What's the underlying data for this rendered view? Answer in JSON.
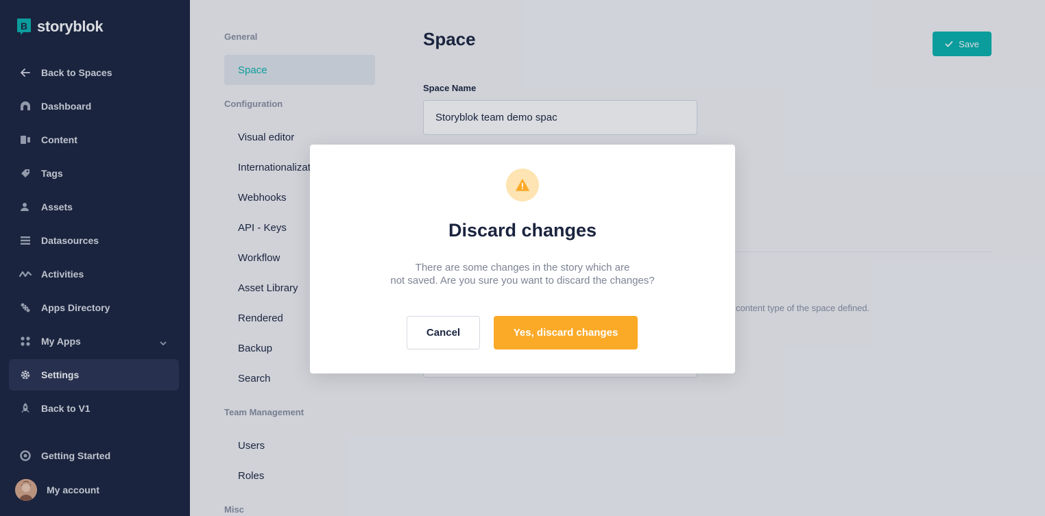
{
  "brand": {
    "name": "storyblok",
    "accent": "#09b3af",
    "sidebar_bg": "#1b243f",
    "warning": "#fbaa28"
  },
  "sidebar": {
    "items": [
      {
        "label": "Back to Spaces",
        "icon": "arrow-left-icon"
      },
      {
        "label": "Dashboard",
        "icon": "dashboard-icon"
      },
      {
        "label": "Content",
        "icon": "content-icon"
      },
      {
        "label": "Tags",
        "icon": "tag-icon"
      },
      {
        "label": "Assets",
        "icon": "assets-icon"
      },
      {
        "label": "Datasources",
        "icon": "datasources-icon"
      },
      {
        "label": "Activities",
        "icon": "activities-icon"
      },
      {
        "label": "Apps Directory",
        "icon": "apps-directory-icon"
      },
      {
        "label": "My Apps",
        "icon": "my-apps-icon"
      },
      {
        "label": "Settings",
        "icon": "gear-icon",
        "active": true
      },
      {
        "label": "Back to V1",
        "icon": "rocket-icon"
      },
      {
        "label": "Getting Started",
        "icon": "lifebuoy-icon"
      },
      {
        "label": "My account",
        "icon": "avatar"
      }
    ]
  },
  "submenu": {
    "general_header": "General",
    "space": "Space",
    "configuration_header": "Configuration",
    "config_items": [
      "Visual editor",
      "Internationalization",
      "Webhooks",
      "API - Keys",
      "Workflow",
      "Asset Library",
      "Rendered",
      "Backup",
      "Search"
    ],
    "team_header": "Team Management",
    "team_items": [
      "Users",
      "Roles"
    ],
    "misc_header": "Misc"
  },
  "main": {
    "title": "Space",
    "save_label": "Save",
    "space_name_label": "Space Name",
    "space_name_value": "Storyblok team demo spac",
    "hint_text": "content type of the space defined."
  },
  "modal": {
    "icon": "warning-icon",
    "title": "Discard changes",
    "text_line1": "There are some changes in the story which are",
    "text_line2": "not saved. Are you sure you want to discard the changes?",
    "cancel_label": "Cancel",
    "confirm_label": "Yes, discard changes"
  }
}
